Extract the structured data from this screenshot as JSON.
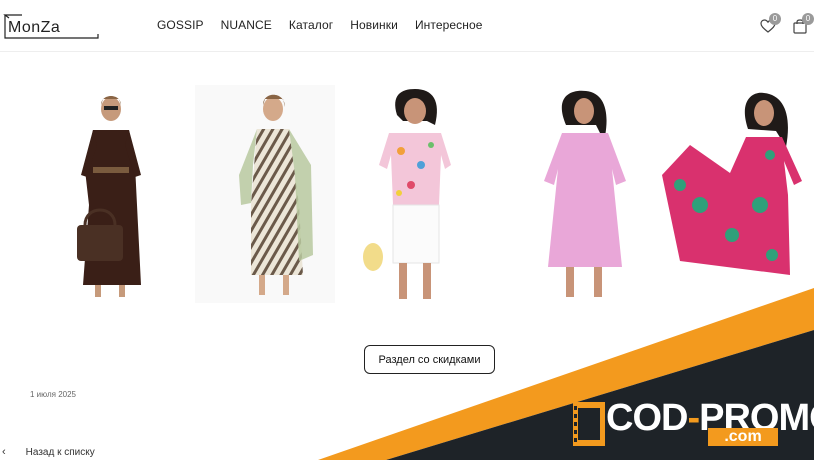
{
  "header": {
    "brand": "MonZa",
    "nav": [
      "GOSSIP",
      "NUANCE",
      "Каталог",
      "Новинки",
      "Интересное"
    ],
    "favorites_count": "0",
    "cart_count": "0"
  },
  "products": [
    {
      "name": "product-brown-dress",
      "dress_color": "#3a1f17"
    },
    {
      "name": "product-striped-dress",
      "dress_color": "#e9e3d6"
    },
    {
      "name": "product-floral-shirt",
      "dress_color": "#f3c6d9"
    },
    {
      "name": "product-pink-dress",
      "dress_color": "#e9a7d8"
    },
    {
      "name": "product-magenta-dress",
      "dress_color": "#d9316e"
    }
  ],
  "main": {
    "sale_button": "Раздел со скидками",
    "date": "1 июля 2025",
    "back_link": "Назад к списку"
  },
  "promo": {
    "brand_main": "COD",
    "brand_dash": "-",
    "brand_second": "PROMO",
    "brand_domain": ".com",
    "colors": {
      "orange": "#f39a1e",
      "dark": "#1e2328"
    }
  }
}
